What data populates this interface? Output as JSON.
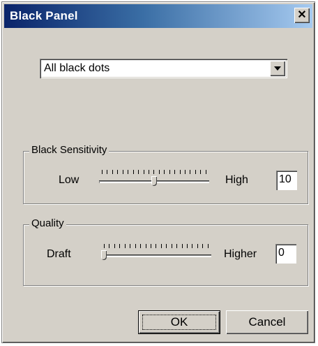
{
  "window": {
    "title": "Black Panel",
    "close_glyph": "✕"
  },
  "mode_select": {
    "value": "All black dots"
  },
  "black_sensitivity": {
    "label": "Black Sensitivity",
    "low_label": "Low",
    "high_label": "High",
    "value": "10",
    "slider_fraction": 0.5
  },
  "quality": {
    "label": "Quality",
    "low_label": "Draft",
    "high_label": "Higher",
    "value": "0",
    "slider_fraction": 0.0
  },
  "buttons": {
    "ok": "OK",
    "cancel": "Cancel"
  },
  "colors": {
    "title_bar_start": "#0a246a",
    "title_bar_end": "#a6caf0",
    "face": "#d4d0c8"
  },
  "icons": {
    "close": "close-icon",
    "dropdown": "chevron-down-icon"
  }
}
